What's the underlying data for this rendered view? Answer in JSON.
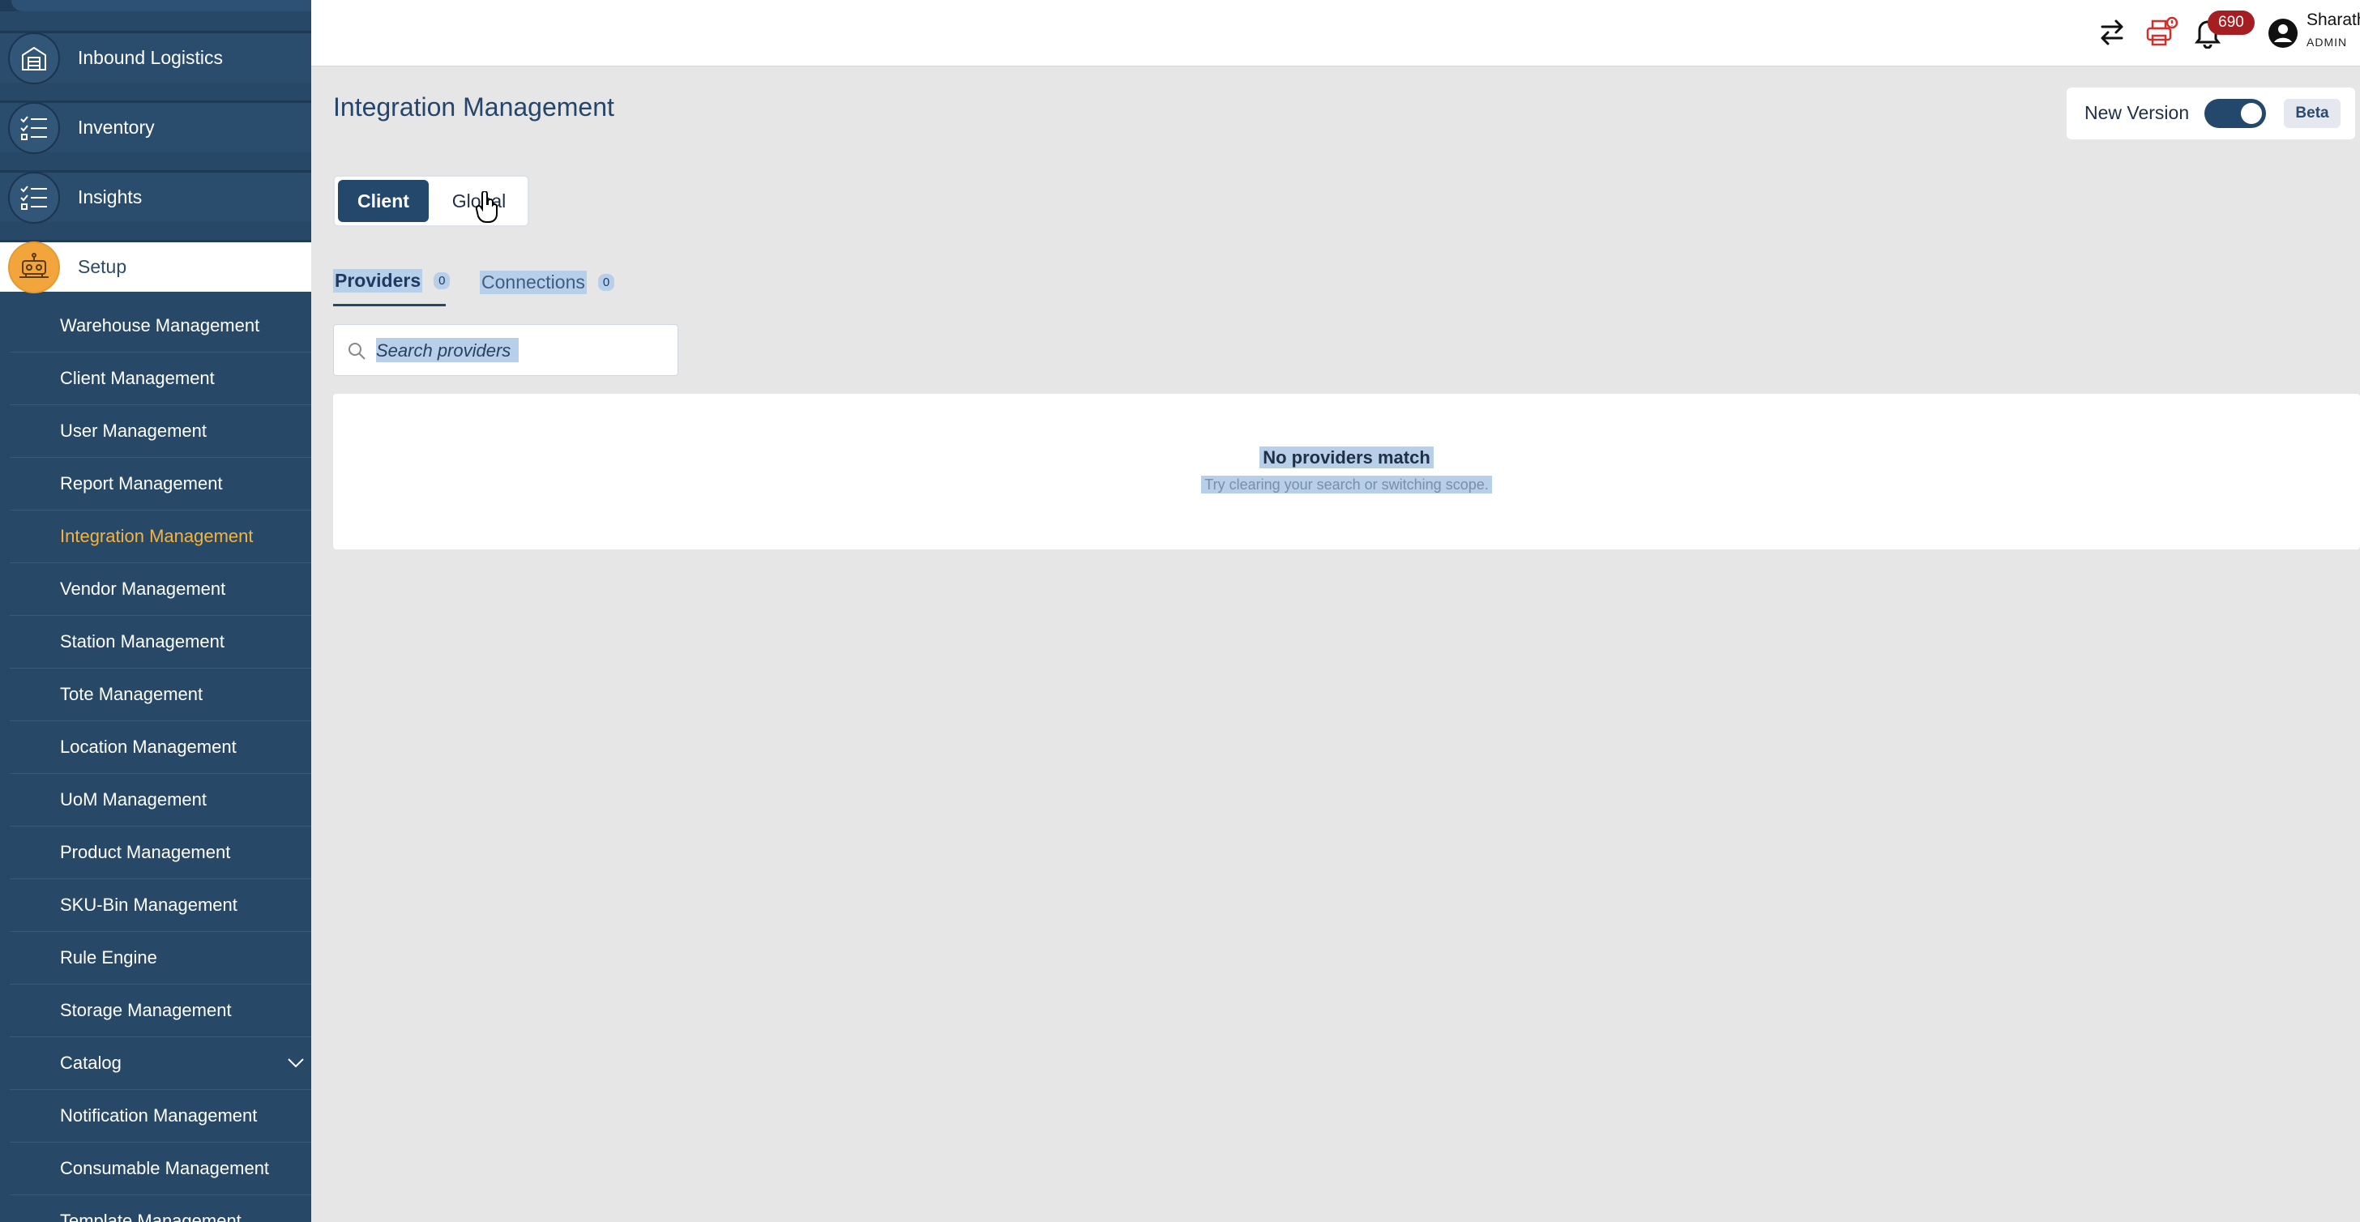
{
  "sidebar": {
    "main_items": [
      {
        "label": "Inbound Logistics",
        "icon": "warehouse-icon"
      },
      {
        "label": "Inventory",
        "icon": "checklist-icon"
      },
      {
        "label": "Insights",
        "icon": "checklist-icon"
      },
      {
        "label": "Setup",
        "icon": "robot-icon"
      }
    ],
    "sub_items": [
      "Warehouse Management",
      "Client Management",
      "User Management",
      "Report Management",
      "Integration Management",
      "Vendor Management",
      "Station Management",
      "Tote Management",
      "Location Management",
      "UoM Management",
      "Product Management",
      "SKU-Bin Management",
      "Rule Engine",
      "Storage Management",
      "Catalog",
      "Notification Management",
      "Consumable Management",
      "Template Management"
    ],
    "active_sub_item": "Integration Management"
  },
  "topbar": {
    "icons": [
      "swap-arrows-icon",
      "printer-alert-icon",
      "bell-icon",
      "user-avatar-icon"
    ],
    "notification_count": "690",
    "user_name": "Sharath",
    "user_role": "ADMIN"
  },
  "page": {
    "title": "Integration Management",
    "version_label": "New Version",
    "version_toggle_on": true,
    "beta_label": "Beta",
    "scope_options": [
      "Client",
      "Global"
    ],
    "scope_selected": "Client",
    "tabs": [
      {
        "label": "Providers",
        "count": "0"
      },
      {
        "label": "Connections",
        "count": "0"
      }
    ],
    "search_placeholder": "Search providers",
    "empty_title": "No providers match",
    "empty_subtitle": "Try clearing your search or switching scope."
  },
  "colors": {
    "sidebar_bg": "#274867",
    "accent_orange": "#f2a53a",
    "primary_navy": "#24476c",
    "badge_red": "#a41e22",
    "selection_blue": "#b7cfe9"
  }
}
